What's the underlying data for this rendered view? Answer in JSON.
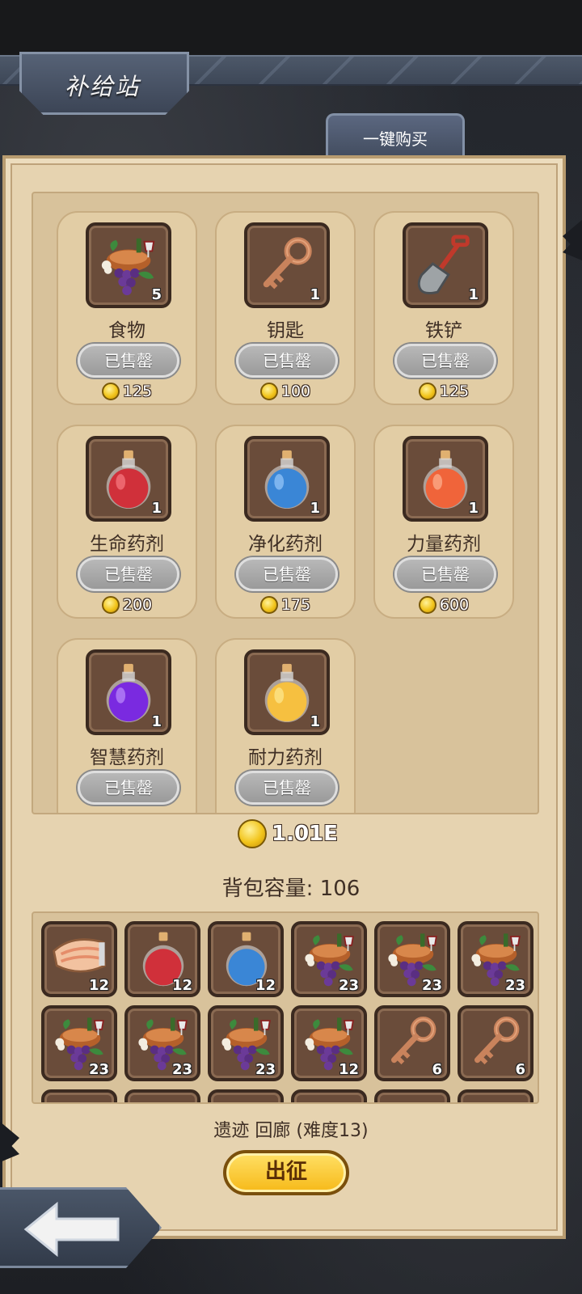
{
  "header": {
    "title": "补给站",
    "buy_all": "一键购买"
  },
  "shop": {
    "items": [
      {
        "name": "食物",
        "qty": "5",
        "status": "已售罄",
        "price": "125",
        "icon": "food-icon"
      },
      {
        "name": "钥匙",
        "qty": "1",
        "status": "已售罄",
        "price": "100",
        "icon": "key-icon"
      },
      {
        "name": "铁铲",
        "qty": "1",
        "status": "已售罄",
        "price": "125",
        "icon": "shovel-icon"
      },
      {
        "name": "生命药剂",
        "qty": "1",
        "status": "已售罄",
        "price": "200",
        "icon": "red-potion-icon"
      },
      {
        "name": "净化药剂",
        "qty": "1",
        "status": "已售罄",
        "price": "175",
        "icon": "blue-potion-icon"
      },
      {
        "name": "力量药剂",
        "qty": "1",
        "status": "已售罄",
        "price": "600",
        "icon": "orange-potion-icon"
      },
      {
        "name": "智慧药剂",
        "qty": "1",
        "status": "已售罄",
        "price": "",
        "icon": "purple-potion-icon"
      },
      {
        "name": "耐力药剂",
        "qty": "1",
        "status": "已售罄",
        "price": "",
        "icon": "yellow-potion-icon"
      }
    ]
  },
  "gold": "1.01E",
  "bag": {
    "capacity_label": "背包容量: 106",
    "slots": [
      {
        "icon": "fish-steak-icon",
        "qty": "12"
      },
      {
        "icon": "red-potion-icon",
        "qty": "12"
      },
      {
        "icon": "blue-potion-icon",
        "qty": "12"
      },
      {
        "icon": "food-icon",
        "qty": "23"
      },
      {
        "icon": "food-icon",
        "qty": "23"
      },
      {
        "icon": "food-icon",
        "qty": "23"
      },
      {
        "icon": "food-icon",
        "qty": "23"
      },
      {
        "icon": "food-icon",
        "qty": "23"
      },
      {
        "icon": "food-icon",
        "qty": "23"
      },
      {
        "icon": "food-icon",
        "qty": "12"
      },
      {
        "icon": "key-icon",
        "qty": "6"
      },
      {
        "icon": "key-icon",
        "qty": "6"
      }
    ]
  },
  "dungeon": "遗迹 回廊 (难度13)",
  "depart": "出征",
  "colors": {
    "parchment": "#e6d3b0",
    "card": "#e2cda5",
    "frame": "#6a4c3a",
    "gold": "#f2c51c",
    "banner": "#4d5869"
  }
}
